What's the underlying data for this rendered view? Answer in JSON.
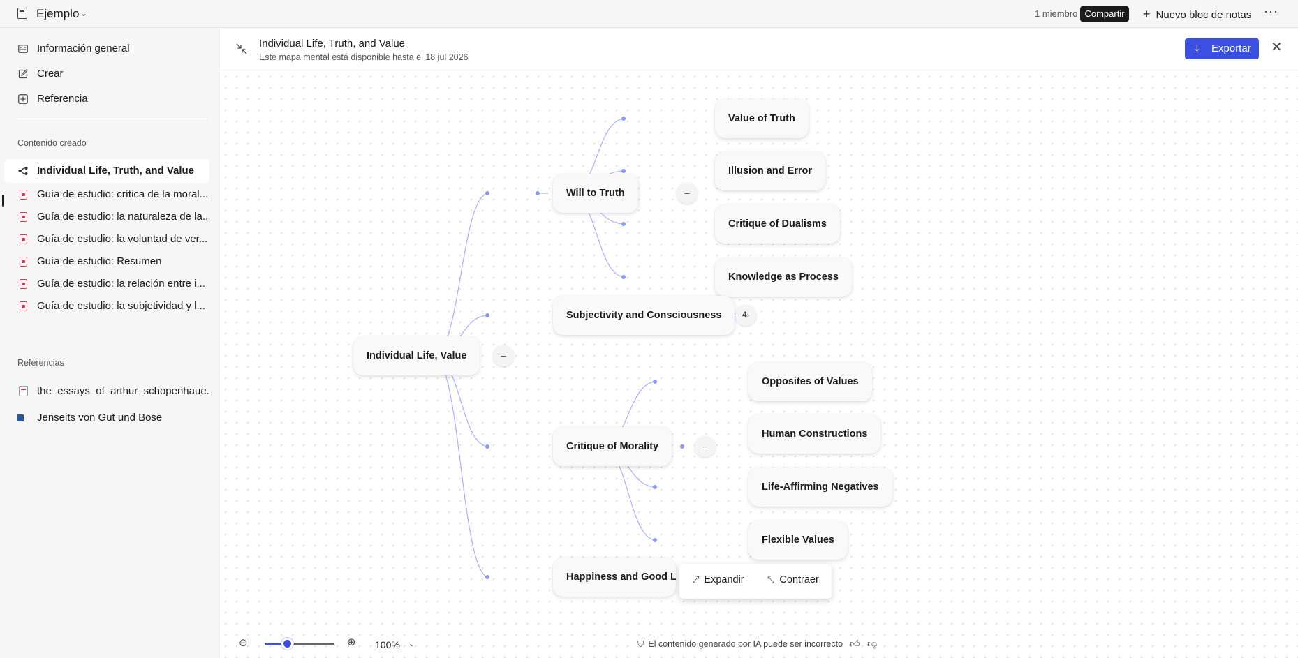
{
  "topbar": {
    "notebook_title": "Ejemplo",
    "members": "1 miembro",
    "share_label": "Compartir",
    "new_notebook_label": "Nuevo bloc de notas",
    "more_label": "···"
  },
  "sidebar": {
    "nav": [
      {
        "label": "Información general",
        "icon": "overview-icon"
      },
      {
        "label": "Crear",
        "icon": "edit-icon"
      },
      {
        "label": "Referencia",
        "icon": "add-reference-icon"
      }
    ],
    "created_section_label": "Contenido creado",
    "created_items": [
      {
        "label": "Individual Life, Truth, and Value",
        "icon": "mindmap-icon",
        "active": true
      },
      {
        "label": "Guía de estudio: crítica de la moral...",
        "icon": "study-guide-icon"
      },
      {
        "label": "Guía de estudio: la naturaleza de la...",
        "icon": "study-guide-icon"
      },
      {
        "label": "Guía de estudio: la voluntad de ver...",
        "icon": "study-guide-icon"
      },
      {
        "label": "Guía de estudio: Resumen",
        "icon": "study-guide-icon"
      },
      {
        "label": "Guía de estudio: la relación entre i...",
        "icon": "study-guide-icon"
      },
      {
        "label": "Guía de estudio: la subjetividad y l...",
        "icon": "study-guide-icon"
      }
    ],
    "references_section_label": "Referencias",
    "references": [
      {
        "label": "the_essays_of_arthur_schopenhaue...",
        "icon": "pdf-file-icon"
      },
      {
        "label": "Jenseits von Gut und Böse",
        "icon": "word-file-icon"
      }
    ]
  },
  "mindmap": {
    "title": "Individual Life, Truth, and Value",
    "subtitle": "Este mapa mental está disponible hasta el 18 jul 2026",
    "export_label": "Exportar",
    "root": "Individual Life, Value",
    "branches": [
      {
        "label": "Will to Truth",
        "expanded": true,
        "children": [
          "Value of Truth",
          "Illusion and Error",
          "Critique of Dualisms",
          "Knowledge as Process"
        ]
      },
      {
        "label": "Subjectivity and Consciousness",
        "expanded": false,
        "hidden_count": "4"
      },
      {
        "label": "Critique of Morality",
        "expanded": true,
        "children": [
          "Opposites of Values",
          "Human Constructions",
          "Life-Affirming Negatives",
          "Flexible Values"
        ]
      },
      {
        "label": "Happiness and Good Life",
        "expanded": false
      }
    ],
    "toggle_collapse_symbol": "–",
    "popup": {
      "expand_label": "Expandir",
      "collapse_label": "Contraer"
    }
  },
  "footer": {
    "zoom_label": "100%",
    "zoom_level": 0.32,
    "ai_disclaimer": "El contenido generado por IA puede ser incorrecto"
  },
  "colors": {
    "accent": "#3b4fe0",
    "connector": "#aab4f5",
    "dark_button": "#1b1b1b"
  }
}
